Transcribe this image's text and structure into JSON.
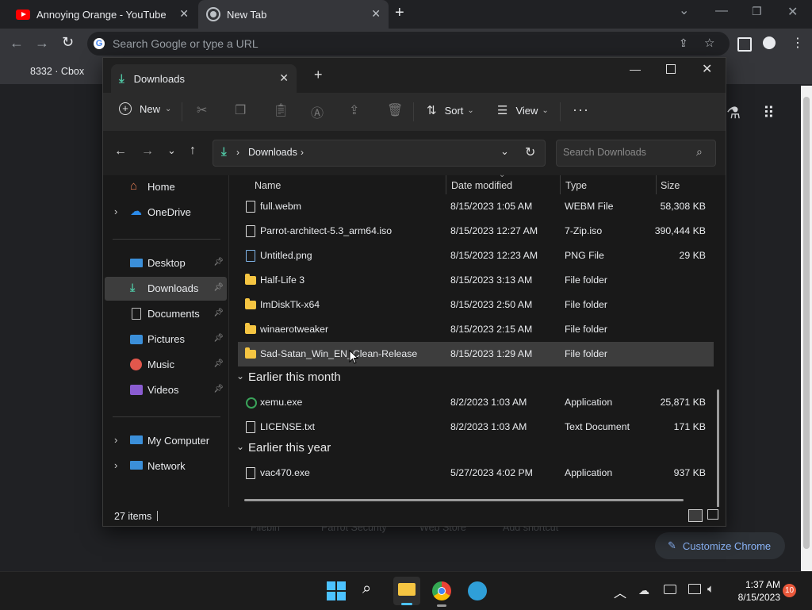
{
  "chrome": {
    "tabs": [
      {
        "label": "Annoying Orange - YouTube"
      },
      {
        "label": "New Tab"
      }
    ],
    "omnibox_placeholder": "Search Google or type a URL",
    "bookmark": "8332 · Cbox",
    "shortcuts": [
      "Filebin",
      "Parrot Security",
      "Web Store",
      "Add shortcut"
    ],
    "customize": "Customize Chrome"
  },
  "explorer": {
    "tab_title": "Downloads",
    "toolbar": {
      "new": "New",
      "sort": "Sort",
      "view": "View"
    },
    "address": {
      "location": "Downloads"
    },
    "search_placeholder": "Search Downloads",
    "nav": {
      "home": "Home",
      "onedrive": "OneDrive",
      "desktop": "Desktop",
      "downloads": "Downloads",
      "documents": "Documents",
      "pictures": "Pictures",
      "music": "Music",
      "videos": "Videos",
      "mycomputer": "My Computer",
      "network": "Network"
    },
    "columns": {
      "name": "Name",
      "date": "Date modified",
      "type": "Type",
      "size": "Size"
    },
    "files": [
      {
        "name": "full.webm",
        "date": "8/15/2023 1:05 AM",
        "type": "WEBM File",
        "size": "58,308 KB"
      },
      {
        "name": "Parrot-architect-5.3_arm64.iso",
        "date": "8/15/2023 12:27 AM",
        "type": "7-Zip.iso",
        "size": "390,444 KB"
      },
      {
        "name": "Untitled.png",
        "date": "8/15/2023 12:23 AM",
        "type": "PNG File",
        "size": "29 KB"
      },
      {
        "name": "Half-Life 3",
        "date": "8/15/2023 3:13 AM",
        "type": "File folder",
        "size": ""
      },
      {
        "name": "ImDiskTk-x64",
        "date": "8/15/2023 2:50 AM",
        "type": "File folder",
        "size": ""
      },
      {
        "name": "winaerotweaker",
        "date": "8/15/2023 2:15 AM",
        "type": "File folder",
        "size": ""
      },
      {
        "name": "Sad-Satan_Win_EN_Clean-Release",
        "date": "8/15/2023 1:29 AM",
        "type": "File folder",
        "size": ""
      }
    ],
    "group_month": "Earlier this month",
    "files_month": [
      {
        "name": "xemu.exe",
        "date": "8/2/2023 1:03 AM",
        "type": "Application",
        "size": "25,871 KB"
      },
      {
        "name": "LICENSE.txt",
        "date": "8/2/2023 1:03 AM",
        "type": "Text Document",
        "size": "171 KB"
      }
    ],
    "group_year": "Earlier this year",
    "files_year": [
      {
        "name": "vac470.exe",
        "date": "5/27/2023 4:02 PM",
        "type": "Application",
        "size": "937 KB"
      }
    ],
    "status": "27 items"
  },
  "taskbar": {
    "time": "1:37 AM",
    "date": "8/15/2023",
    "notifications": "10"
  }
}
